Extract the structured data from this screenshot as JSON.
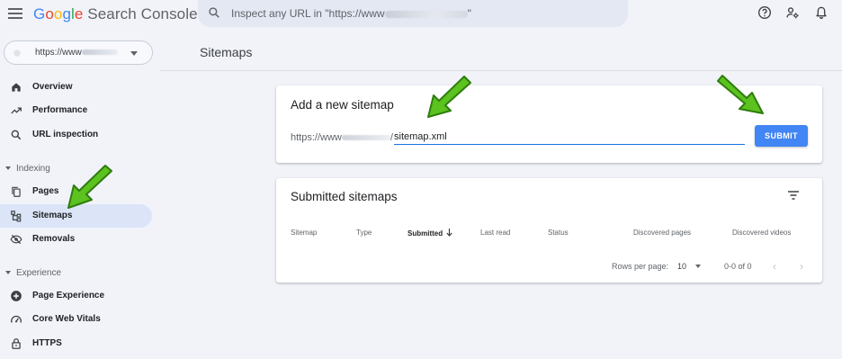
{
  "app": {
    "brand": "Google",
    "product": "Search Console"
  },
  "search": {
    "placeholder_start": "Inspect any URL in \"https://www",
    "placeholder_end": "\""
  },
  "property": {
    "label": "https://www"
  },
  "sidebar": {
    "items": [
      {
        "label": "Overview",
        "icon": "home-icon"
      },
      {
        "label": "Performance",
        "icon": "trending-up-icon"
      },
      {
        "label": "URL inspection",
        "icon": "search-icon"
      }
    ],
    "indexing": {
      "heading": "Indexing",
      "items": [
        {
          "label": "Pages",
          "icon": "pages-icon"
        },
        {
          "label": "Sitemaps",
          "icon": "sitemap-icon",
          "active": true
        },
        {
          "label": "Removals",
          "icon": "visibility-off-icon"
        }
      ]
    },
    "experience": {
      "heading": "Experience",
      "items": [
        {
          "label": "Page Experience",
          "icon": "add-circle-icon"
        },
        {
          "label": "Core Web Vitals",
          "icon": "speed-icon"
        },
        {
          "label": "HTTPS",
          "icon": "lock-icon"
        }
      ]
    }
  },
  "main": {
    "title": "Sitemaps",
    "add_card": {
      "title": "Add a new sitemap",
      "prefix": "https://www",
      "prefix_end": "/",
      "input_value": "sitemap.xml",
      "submit_label": "SUBMIT"
    },
    "submitted_card": {
      "title": "Submitted sitemaps",
      "columns": [
        "Sitemap",
        "Type",
        "Submitted",
        "Last read",
        "Status",
        "Discovered pages",
        "Discovered videos"
      ],
      "sorted_column": "Submitted",
      "rows_per_page_label": "Rows per page:",
      "rows_per_page_value": "10",
      "range": "0-0 of 0"
    }
  },
  "colors": {
    "accent": "#4285f4",
    "active_bg": "#dbe5f7",
    "arrow_green": "#5bc21f"
  }
}
